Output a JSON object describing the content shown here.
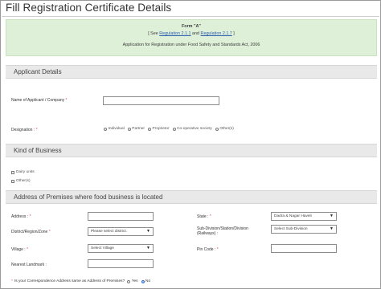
{
  "page": {
    "title": "Fill Registration Certificate Details"
  },
  "banner": {
    "form_title": "Form \"A\"",
    "ref_open": "[ See ",
    "ref_link1": "Regulation 2.1.1",
    "ref_and": " and ",
    "ref_link2": "Regulation 2.1.7",
    "ref_close": " ]",
    "application_text": "Application for Registration under Food Safety and Standards Act, 2006"
  },
  "applicant_details": {
    "heading": "Applicant Details",
    "name_label": "Name of Applicant / Company",
    "name_value": "",
    "designation_label": "Designation :",
    "required_mark": "*",
    "designation_options": [
      "Individual",
      "Partner",
      "Proprietor",
      "Co-operative society",
      "Other(s)"
    ]
  },
  "kind_of_business": {
    "heading": "Kind of Business",
    "options": [
      "Dairy units",
      "Other(s)"
    ]
  },
  "premises": {
    "heading": "Address of Premises where food business is located",
    "address_label": "Address :",
    "address_value": "",
    "district_label": "District/Region/Zone",
    "district_selected": "Please select district.",
    "village_label": "Village :",
    "village_selected": "Select Village",
    "landmark_label": "Nearest Landmark :",
    "landmark_value": "",
    "state_label": "State :",
    "state_selected": "Dadra & Nagar Haveli",
    "subdivision_label_line1": "Sub-Division/Station/Division",
    "subdivision_label_line2": "(Railways) :",
    "subdivision_selected": "Select Sub-Division",
    "pincode_label": "Pin Code :",
    "pincode_value": ""
  },
  "correspondence": {
    "question": "Is your Correspondence Address same as Address of Premises?",
    "yes_label": "Yes",
    "no_label": "No",
    "selected": "No"
  },
  "colors": {
    "banner_bg": "#dff0d8",
    "section_bg": "#e9e9e9",
    "required": "#d9534f",
    "link": "#2a5db0"
  },
  "icons": {
    "select_caret": "caret-down-icon",
    "radio": "radio-icon",
    "checkbox": "checkbox-icon"
  }
}
